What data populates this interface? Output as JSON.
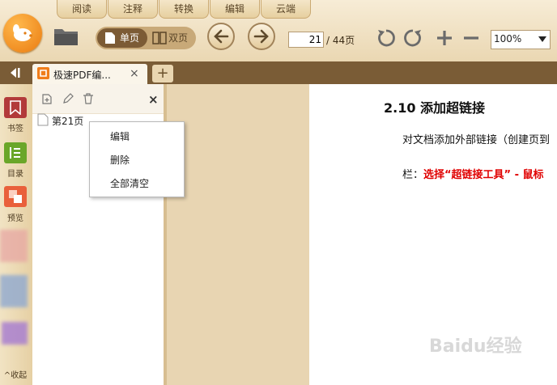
{
  "menu_tabs": [
    "阅读",
    "注释",
    "转换",
    "编辑",
    "云端"
  ],
  "toolbar": {
    "single_page": "单页",
    "double_page": "双页",
    "page_current": "21",
    "page_total": "/ 44页",
    "zoom": "100%"
  },
  "doc_tab": {
    "title": "极速PDF编...",
    "close": "×",
    "new_tab": "+"
  },
  "sidebar": {
    "items": [
      {
        "label": "书签",
        "icon": "bookmark-icon",
        "color": "#b23a3a"
      },
      {
        "label": "目录",
        "icon": "toc-icon",
        "color": "#6aa629"
      },
      {
        "label": "预览",
        "icon": "preview-icon",
        "color": "#e9603b"
      }
    ],
    "collapse_label": "^收起"
  },
  "bookmark_panel": {
    "close": "×",
    "items": [
      {
        "label": "第21页"
      }
    ]
  },
  "context_menu": {
    "items": [
      "编辑",
      "删除",
      "全部清空"
    ]
  },
  "document": {
    "heading": "2.10 添加超链接",
    "line1": "对文档添加外部链接（创建页到",
    "line2_prefix": "栏：",
    "line2_red": "选择“超链接工具” - 鼠标"
  },
  "watermark": "Baidu经验"
}
